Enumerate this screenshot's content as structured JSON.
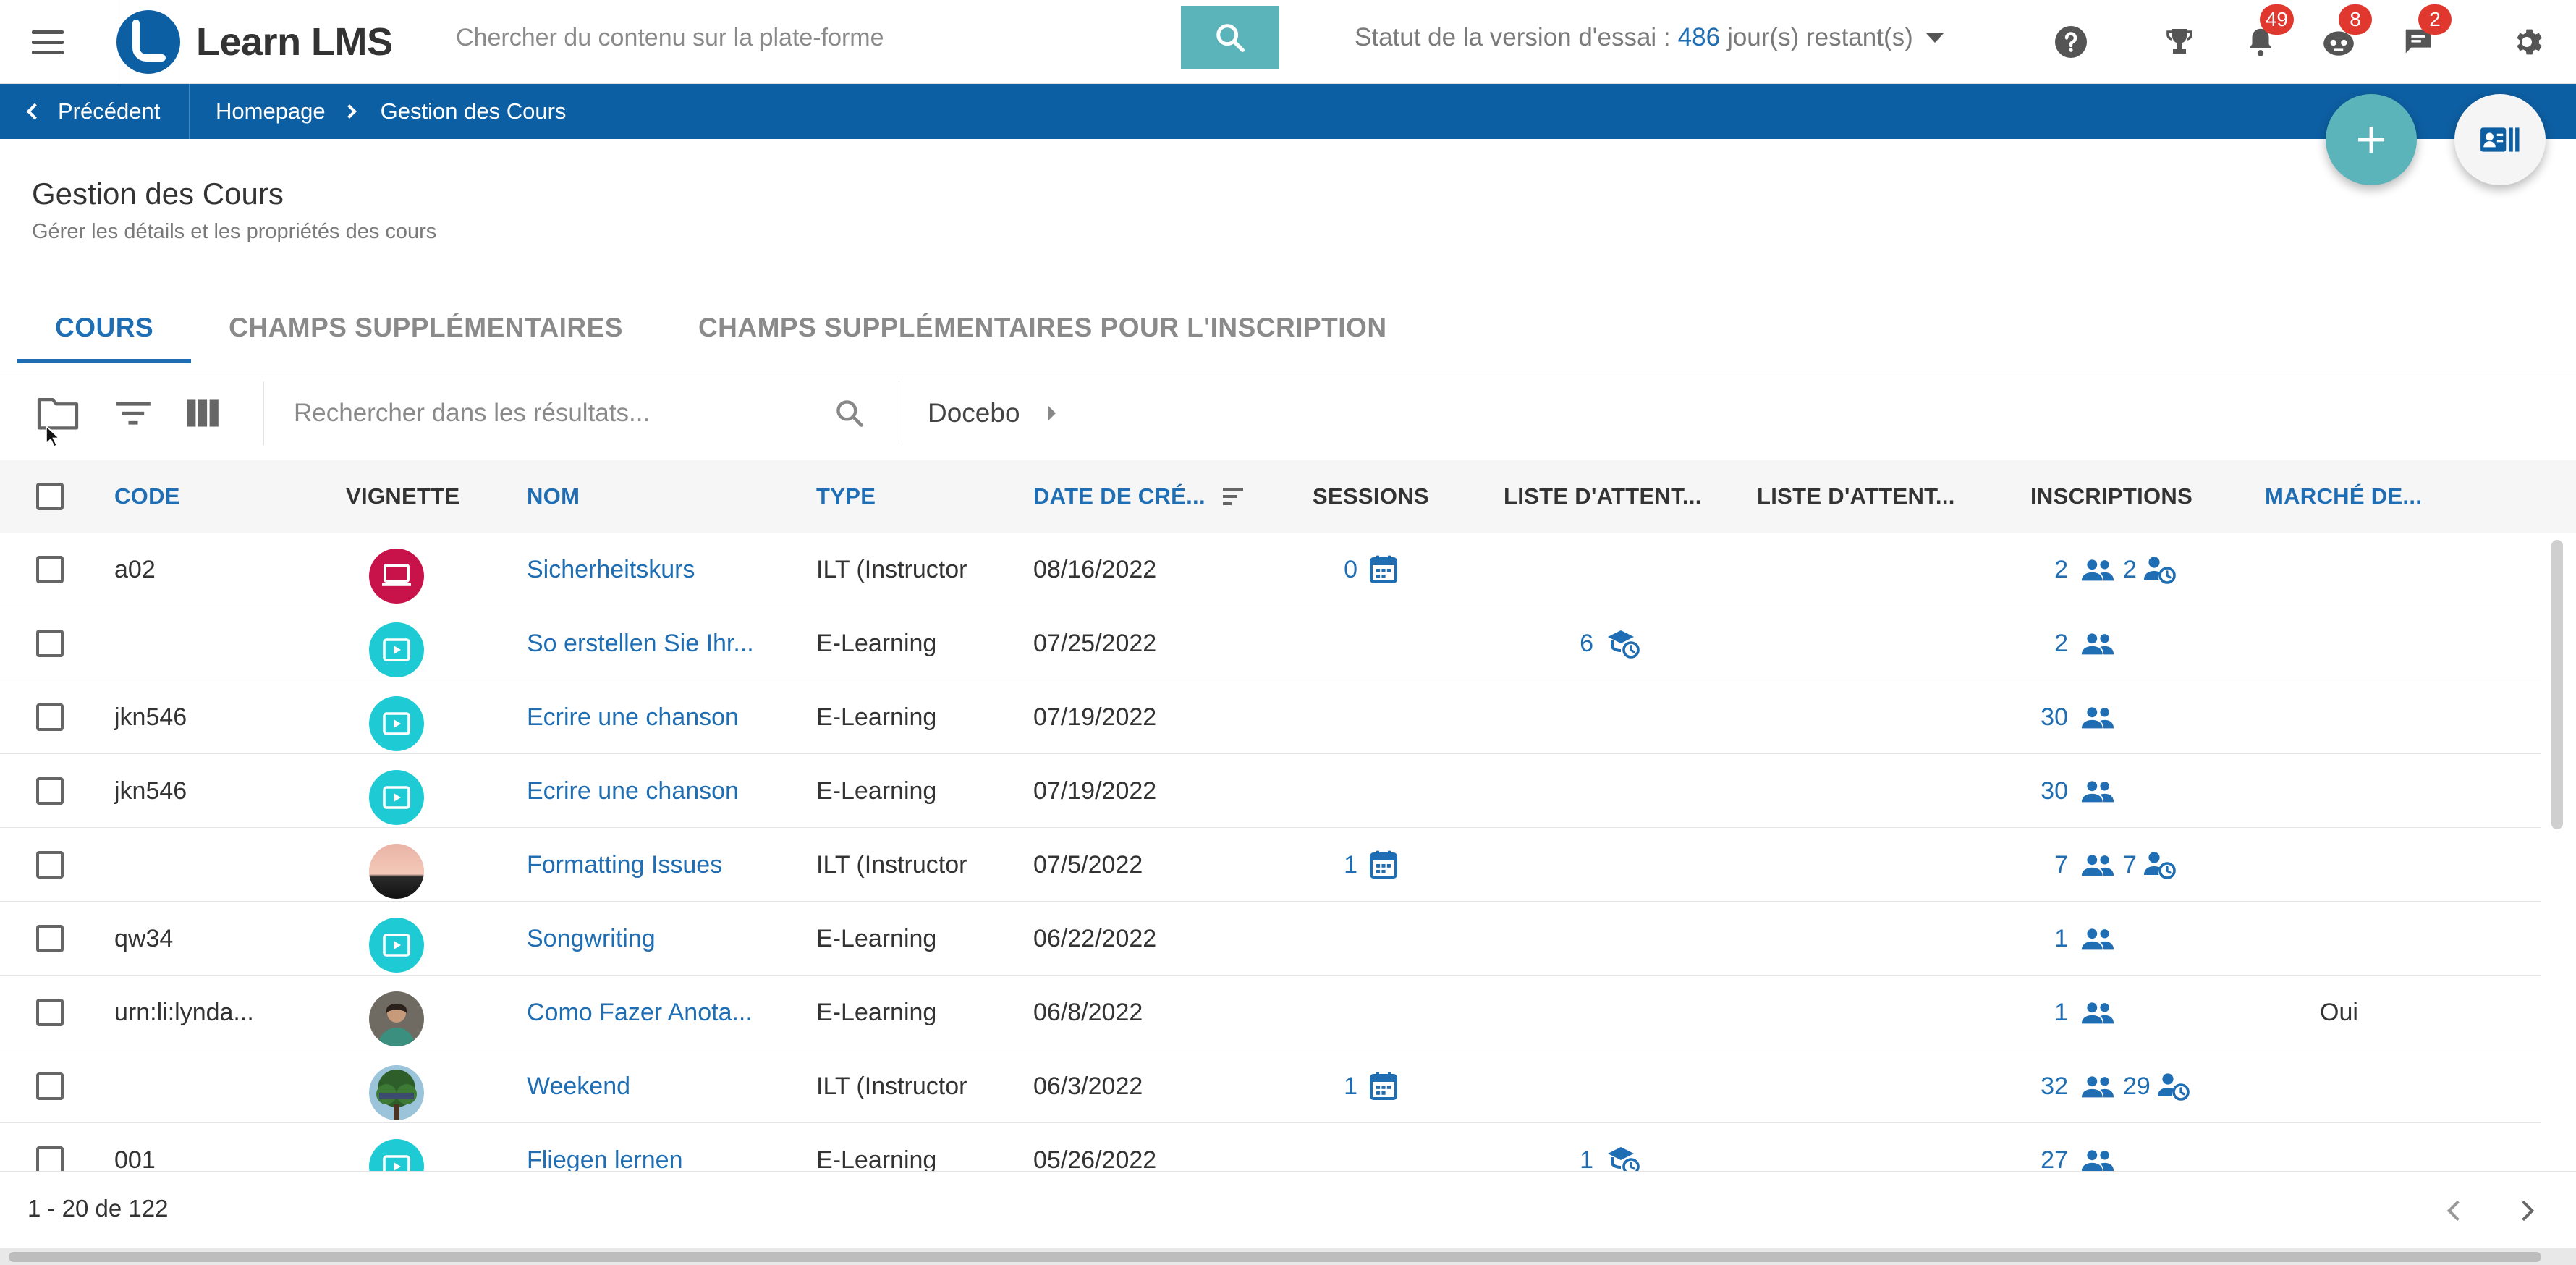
{
  "app": {
    "logo_text": "Learn LMS",
    "search_placeholder": "Chercher du contenu sur la plate-forme",
    "trial_label": "Statut de la version d'essai :",
    "trial_days": "486",
    "trial_suffix": "jour(s) restant(s)",
    "badges": {
      "notifications": "49",
      "assistant": "8",
      "messages": "2"
    },
    "icons": [
      "menu-icon",
      "search-icon",
      "help-icon",
      "trophy-icon",
      "bell-icon",
      "bot-icon",
      "chat-icon",
      "gear-icon"
    ],
    "colors": {
      "brand": "#0d5fa3",
      "accent": "#5ab4ba",
      "link": "#1f6eb3",
      "badge": "#e0382f"
    }
  },
  "breadcrumb": {
    "back_label": "Précédent",
    "items": [
      "Homepage",
      "Gestion des Cours"
    ]
  },
  "page": {
    "title": "Gestion des Cours",
    "subtitle": "Gérer les détails et les propriétés des cours"
  },
  "tabs": [
    {
      "label": "COURS",
      "active": true
    },
    {
      "label": "CHAMPS SUPPLÉMENTAIRES",
      "active": false
    },
    {
      "label": "CHAMPS SUPPLÉMENTAIRES POUR L'INSCRIPTION",
      "active": false
    }
  ],
  "toolbar": {
    "search_placeholder": "Rechercher dans les résultats...",
    "folder": "Docebo"
  },
  "table": {
    "headers": {
      "code": "CODE",
      "thumbnail": "VIGNETTE",
      "name": "NOM",
      "type": "TYPE",
      "date": "DATE DE CRÉ...",
      "sessions": "SESSIONS",
      "waitlist1": "LISTE D'ATTENT...",
      "waitlist2": "LISTE D'ATTENT...",
      "enrollments": "INSCRIPTIONS",
      "market": "MARCHÉ DE..."
    },
    "rows": [
      {
        "code": "a02",
        "thumb": "ilt",
        "name": "Sicherheitskurs",
        "type": "ILT (Instructor",
        "date": "08/16/2022",
        "sessions": "0",
        "waitlist": "",
        "enroll": "2",
        "enroll2": "2",
        "market": ""
      },
      {
        "code": "",
        "thumb": "elearn",
        "name": "So erstellen Sie Ihr...",
        "type": "E-Learning",
        "date": "07/25/2022",
        "sessions": "",
        "waitlist": "6",
        "enroll": "2",
        "enroll2": "",
        "market": ""
      },
      {
        "code": "jkn546",
        "thumb": "elearn",
        "name": "Ecrire une chanson",
        "type": "E-Learning",
        "date": "07/19/2022",
        "sessions": "",
        "waitlist": "",
        "enroll": "30",
        "enroll2": "",
        "market": ""
      },
      {
        "code": "jkn546",
        "thumb": "elearn",
        "name": "Ecrire une chanson",
        "type": "E-Learning",
        "date": "07/19/2022",
        "sessions": "",
        "waitlist": "",
        "enroll": "30",
        "enroll2": "",
        "market": ""
      },
      {
        "code": "",
        "thumb": "photo-sunset",
        "name": "Formatting Issues",
        "type": "ILT (Instructor",
        "date": "07/5/2022",
        "sessions": "1",
        "waitlist": "",
        "enroll": "7",
        "enroll2": "7",
        "market": ""
      },
      {
        "code": "qw34",
        "thumb": "elearn",
        "name": "Songwriting",
        "type": "E-Learning",
        "date": "06/22/2022",
        "sessions": "",
        "waitlist": "",
        "enroll": "1",
        "enroll2": "",
        "market": ""
      },
      {
        "code": "urn:li:lynda...",
        "thumb": "photo-person",
        "name": "Como Fazer Anota...",
        "type": "E-Learning",
        "date": "06/8/2022",
        "sessions": "",
        "waitlist": "",
        "enroll": "1",
        "enroll2": "",
        "market": "Oui"
      },
      {
        "code": "",
        "thumb": "photo-tree",
        "name": "Weekend",
        "type": "ILT (Instructor",
        "date": "06/3/2022",
        "sessions": "1",
        "waitlist": "",
        "enroll": "32",
        "enroll2": "29",
        "market": ""
      },
      {
        "code": "001",
        "thumb": "elearn",
        "name": "Fliegen lernen",
        "type": "E-Learning",
        "date": "05/26/2022",
        "sessions": "",
        "waitlist": "1",
        "enroll": "27",
        "enroll2": "",
        "market": ""
      }
    ]
  },
  "pagination": {
    "text": "1 - 20 de 122"
  }
}
